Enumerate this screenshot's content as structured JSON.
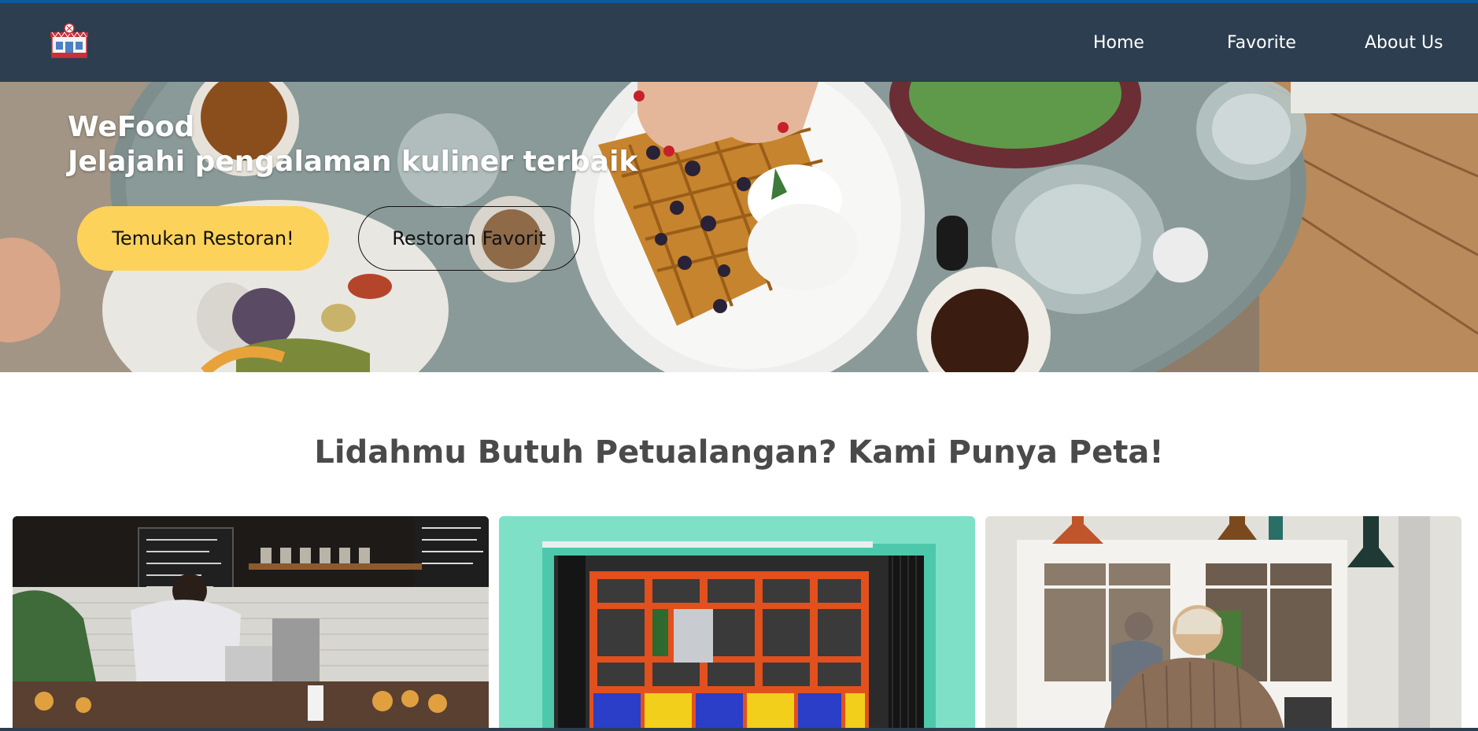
{
  "nav": {
    "logo_icon": "restaurant-building-icon",
    "items": [
      {
        "label": "Home"
      },
      {
        "label": "Favorite"
      },
      {
        "label": "About Us"
      }
    ]
  },
  "hero": {
    "brand": "WeFood",
    "tagline": "Jelajahi pengalaman kuliner terbaik",
    "primary_button": "Temukan Restoran!",
    "secondary_button": "Restoran Favorit"
  },
  "section": {
    "heading": "Lidahmu Butuh Petualangan? Kami Punya Peta!"
  },
  "colors": {
    "navbar": "#2d3e50",
    "accent_yellow": "#fdd25a",
    "heading_text": "#4a4a4a"
  }
}
